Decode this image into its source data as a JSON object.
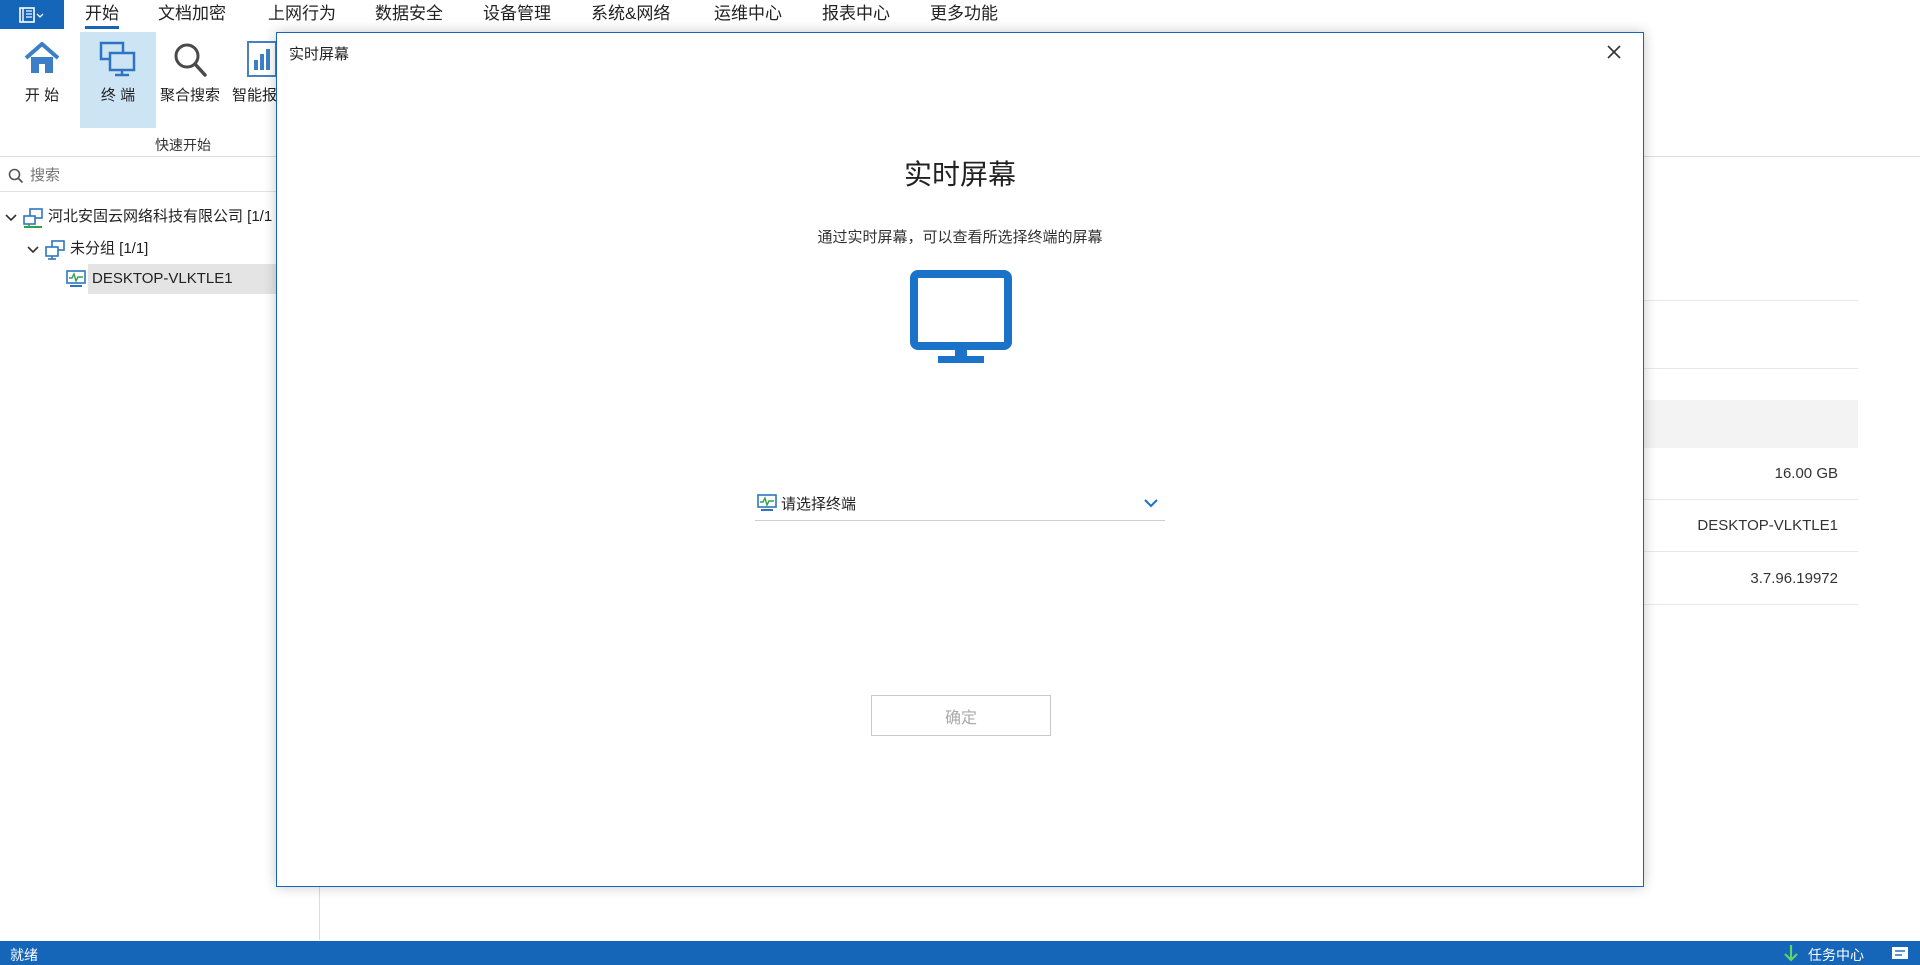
{
  "menubar": {
    "tabs": [
      {
        "label": "开始"
      },
      {
        "label": "文档加密"
      },
      {
        "label": "上网行为"
      },
      {
        "label": "数据安全"
      },
      {
        "label": "设备管理"
      },
      {
        "label": "系统&网络"
      },
      {
        "label": "运维中心"
      },
      {
        "label": "报表中心"
      },
      {
        "label": "更多功能"
      }
    ]
  },
  "ribbon": {
    "buttons": [
      {
        "label": "开 始",
        "icon": "home-icon"
      },
      {
        "label": "终 端",
        "icon": "terminal-icon"
      },
      {
        "label": "聚合搜索",
        "icon": "search-icon"
      },
      {
        "label": "智能报",
        "icon": "report-icon"
      }
    ],
    "group_label": "快速开始"
  },
  "sidebar": {
    "search_placeholder": "搜索",
    "tree": {
      "company": "河北安固云网络科技有限公司 [1/1",
      "group": "未分组 [1/1]",
      "device": "DESKTOP-VLKTLE1"
    }
  },
  "background_info": {
    "values": [
      "16.00 GB",
      "DESKTOP-VLKTLE1",
      "3.7.96.19972"
    ]
  },
  "dialog": {
    "title": "实时屏幕",
    "heading": "实时屏幕",
    "description": "通过实时屏幕，可以查看所选择终端的屏幕",
    "select_placeholder": "请选择终端",
    "confirm_label": "确定",
    "accent_color": "#1a73c8"
  },
  "statusbar": {
    "status": "就绪",
    "task_center": "任务中心"
  }
}
